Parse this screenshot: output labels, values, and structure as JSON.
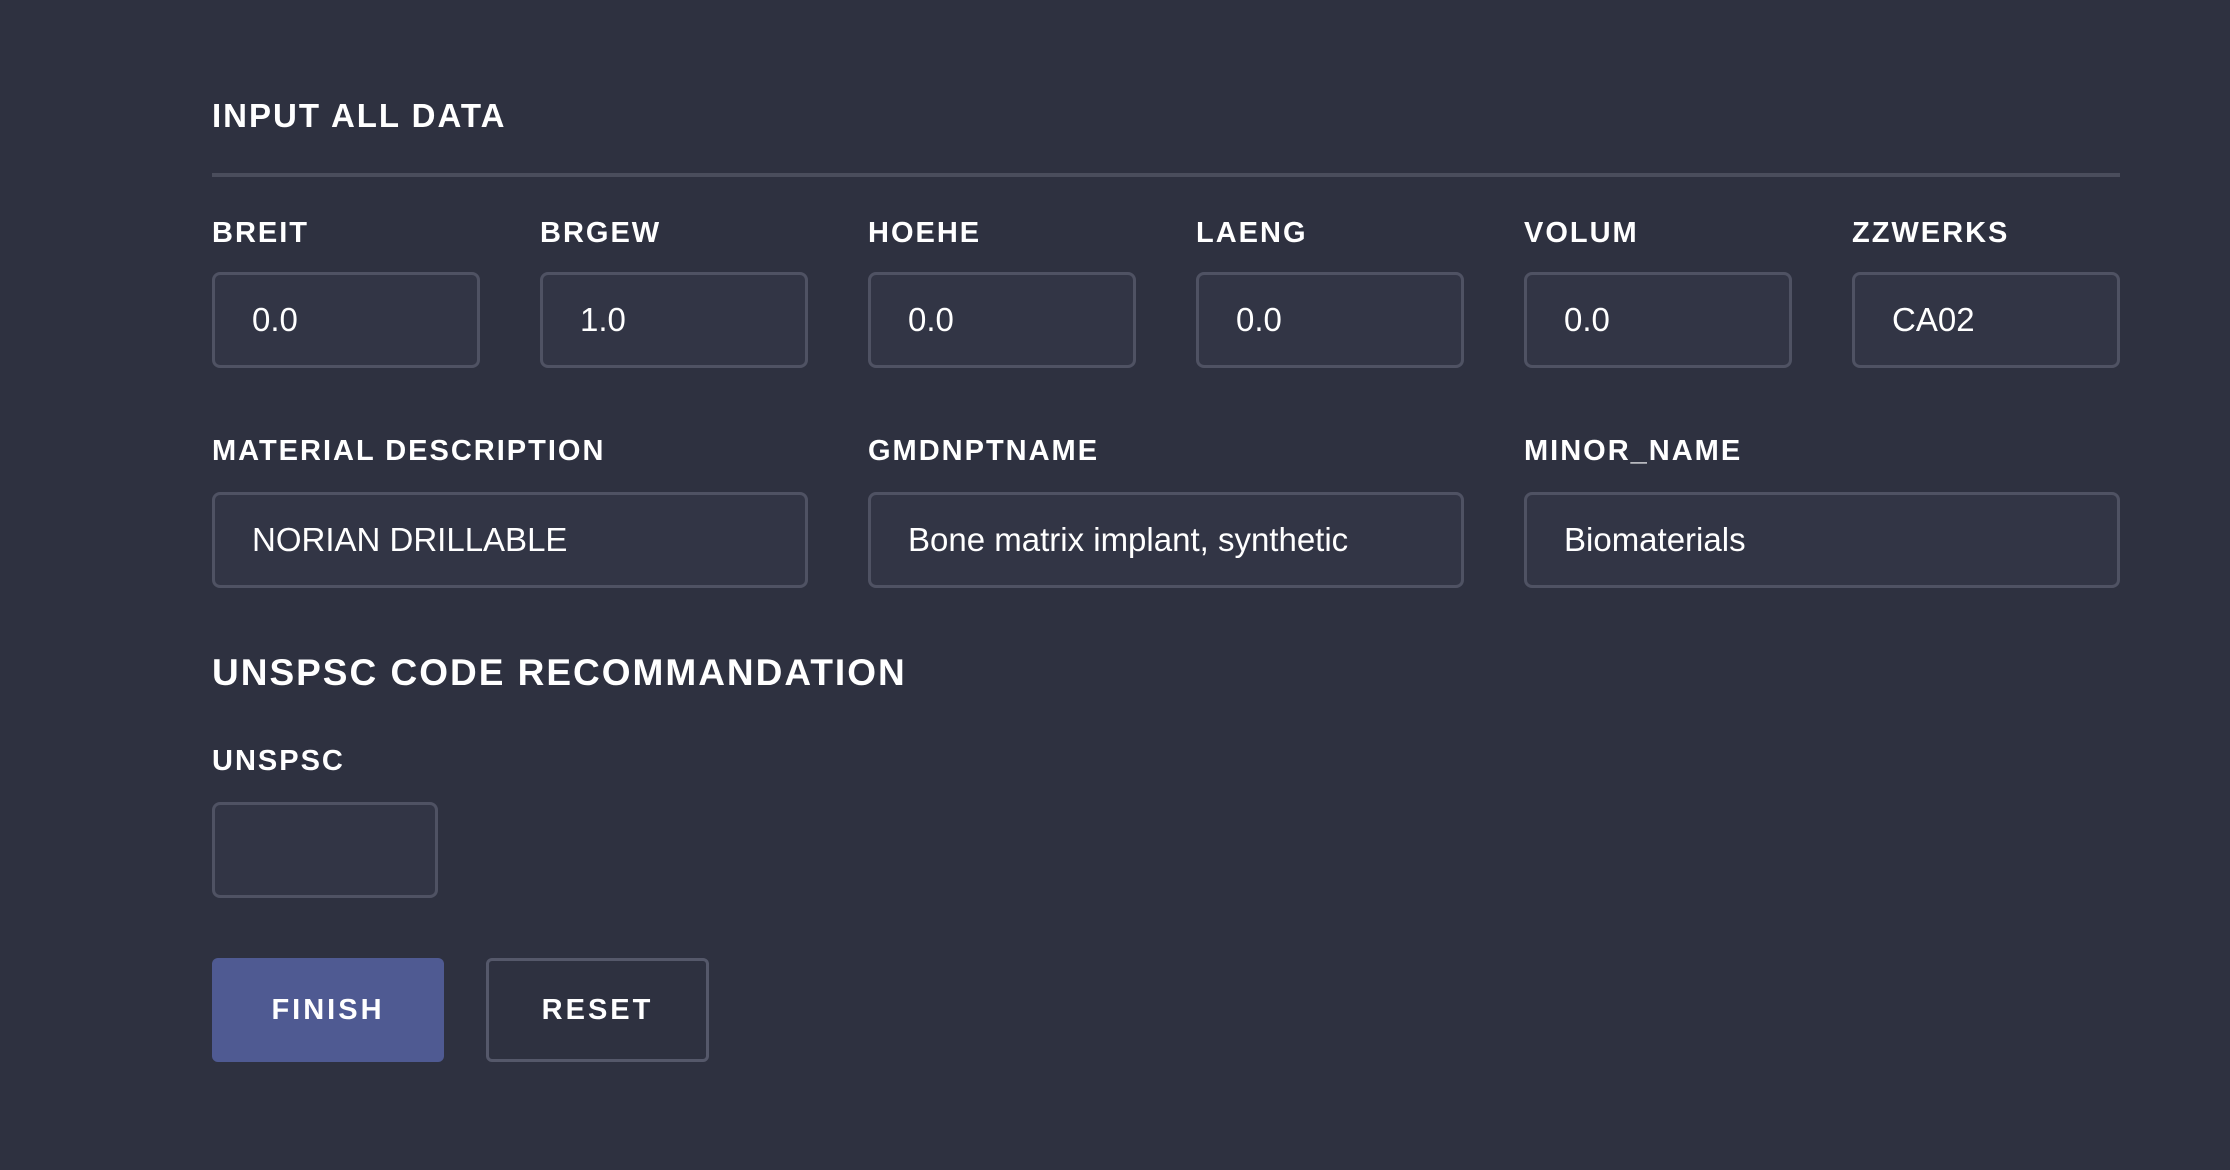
{
  "form": {
    "title": "INPUT ALL DATA",
    "fields": [
      {
        "label": "BREIT",
        "value": "0.0"
      },
      {
        "label": "BRGEW",
        "value": "1.0"
      },
      {
        "label": "HOEHE",
        "value": "0.0"
      },
      {
        "label": "LAENG",
        "value": "0.0"
      },
      {
        "label": "VOLUM",
        "value": "0.0"
      },
      {
        "label": "ZZWERKS",
        "value": "CA02"
      },
      {
        "label": "MATERIAL DESCRIPTION",
        "value": "NORIAN DRILLABLE"
      },
      {
        "label": "GMDNPTNAME",
        "value": "Bone matrix implant, synthetic"
      },
      {
        "label": "MINOR_NAME",
        "value": "Biomaterials"
      }
    ]
  },
  "recommendation": {
    "title": "UNSPSC CODE RECOMMANDATION",
    "unspsc_label": "UNSPSC",
    "unspsc_value": ""
  },
  "actions": {
    "finish_label": "FINISH",
    "reset_label": "RESET",
    "finish_color": "#4f5a92"
  }
}
